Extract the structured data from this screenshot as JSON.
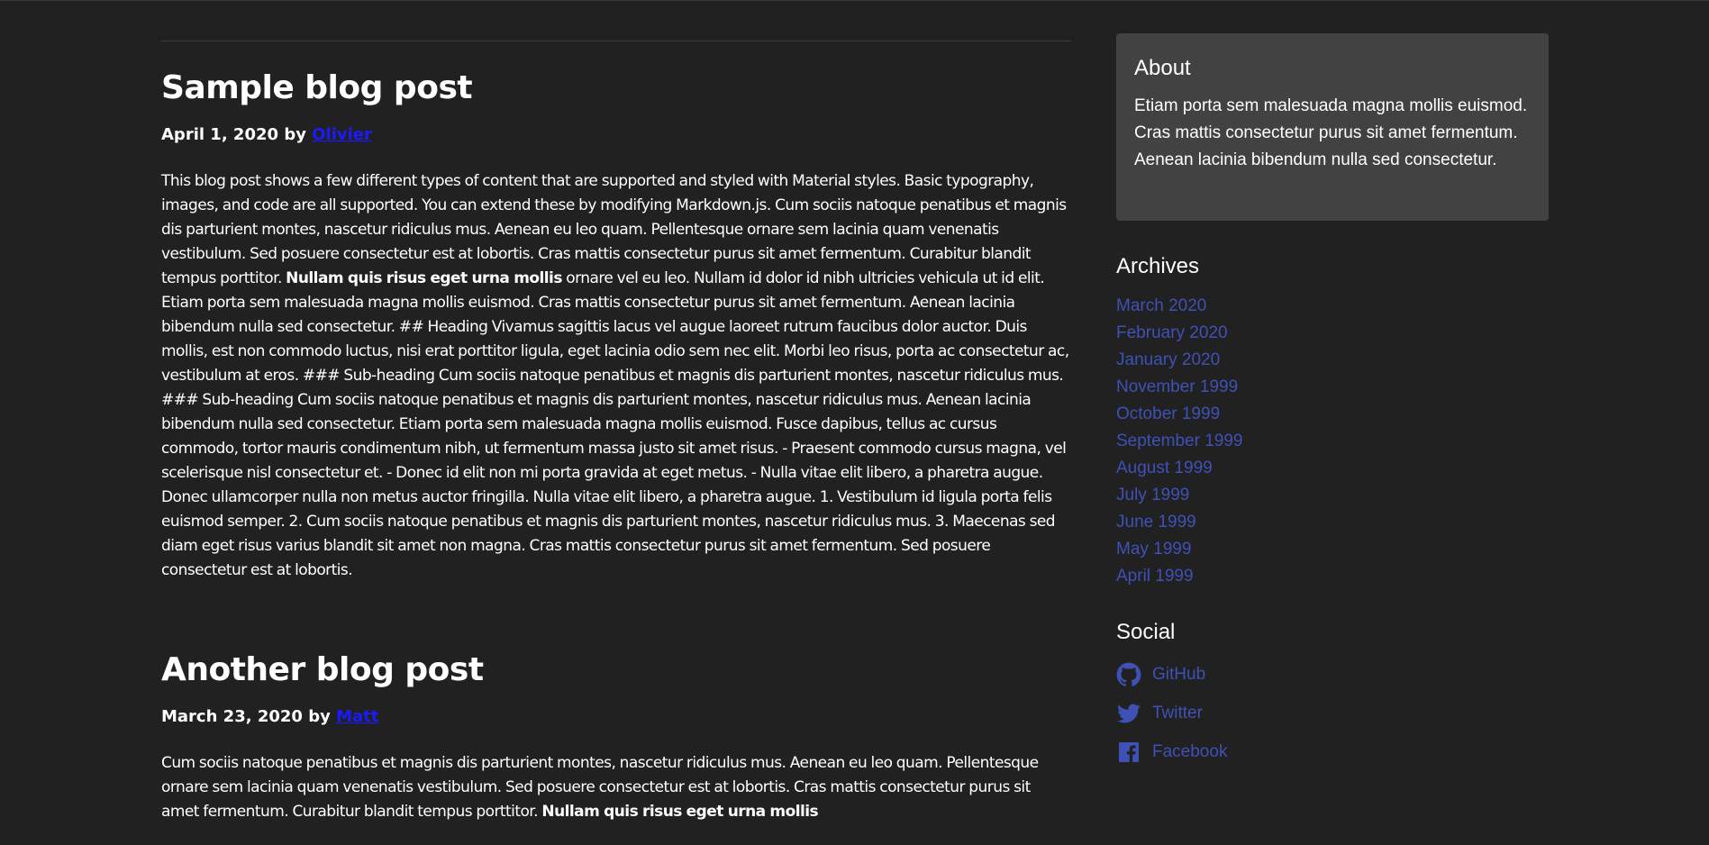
{
  "posts": [
    {
      "title": "Sample blog post",
      "date": "April 1, 2020",
      "by": "by",
      "author": "Olivier",
      "body_before_bold": "This blog post shows a few different types of content that are supported and styled with Material styles. Basic typography, images, and code are all supported. You can extend these by modifying Markdown.js. Cum sociis natoque penatibus et magnis dis parturient montes, nascetur ridiculus mus. Aenean eu leo quam. Pellentesque ornare sem lacinia quam venenatis vestibulum. Sed posuere consectetur est at lobortis. Cras mattis consectetur purus sit amet fermentum. Curabitur blandit tempus porttitor.",
      "body_bold": "Nullam quis risus eget urna mollis",
      "body_after_bold": "ornare vel eu leo. Nullam id dolor id nibh ultricies vehicula ut id elit. Etiam porta sem malesuada magna mollis euismod. Cras mattis consectetur purus sit amet fermentum. Aenean lacinia bibendum nulla sed consectetur. ## Heading Vivamus sagittis lacus vel augue laoreet rutrum faucibus dolor auctor. Duis mollis, est non commodo luctus, nisi erat porttitor ligula, eget lacinia odio sem nec elit. Morbi leo risus, porta ac consectetur ac, vestibulum at eros. ### Sub-heading Cum sociis natoque penatibus et magnis dis parturient montes, nascetur ridiculus mus. ### Sub-heading Cum sociis natoque penatibus et magnis dis parturient montes, nascetur ridiculus mus. Aenean lacinia bibendum nulla sed consectetur. Etiam porta sem malesuada magna mollis euismod. Fusce dapibus, tellus ac cursus commodo, tortor mauris condimentum nibh, ut fermentum massa justo sit amet risus. - Praesent commodo cursus magna, vel scelerisque nisl consectetur et. - Donec id elit non mi porta gravida at eget metus. - Nulla vitae elit libero, a pharetra augue. Donec ullamcorper nulla non metus auctor fringilla. Nulla vitae elit libero, a pharetra augue. 1. Vestibulum id ligula porta felis euismod semper. 2. Cum sociis natoque penatibus et magnis dis parturient montes, nascetur ridiculus mus. 3. Maecenas sed diam eget risus varius blandit sit amet non magna. Cras mattis consectetur purus sit amet fermentum. Sed posuere consectetur est at lobortis."
    },
    {
      "title": "Another blog post",
      "date": "March 23, 2020",
      "by": "by",
      "author": "Matt",
      "body_before_bold": "Cum sociis natoque penatibus et magnis dis parturient montes, nascetur ridiculus mus. Aenean eu leo quam. Pellentesque ornare sem lacinia quam venenatis vestibulum. Sed posuere consectetur est at lobortis. Cras mattis consectetur purus sit amet fermentum. Curabitur blandit tempus porttitor.",
      "body_bold": "Nullam quis risus eget urna mollis",
      "body_after_bold": ""
    }
  ],
  "sidebar": {
    "about": {
      "title": "About",
      "text": "Etiam porta sem malesuada magna mollis euismod. Cras mattis consectetur purus sit amet fermentum. Aenean lacinia bibendum nulla sed consectetur."
    },
    "archives": {
      "title": "Archives",
      "items": [
        "March 2020",
        "February 2020",
        "January 2020",
        "November 1999",
        "October 1999",
        "September 1999",
        "August 1999",
        "July 1999",
        "June 1999",
        "May 1999",
        "April 1999"
      ]
    },
    "social": {
      "title": "Social",
      "items": [
        {
          "label": "GitHub",
          "icon": "github-icon"
        },
        {
          "label": "Twitter",
          "icon": "twitter-icon"
        },
        {
          "label": "Facebook",
          "icon": "facebook-icon"
        }
      ]
    }
  },
  "colors": {
    "background": "#212121",
    "card": "#424242",
    "link": "#3f51b5",
    "author_link": "#1a1aff",
    "text": "#ffffff"
  }
}
